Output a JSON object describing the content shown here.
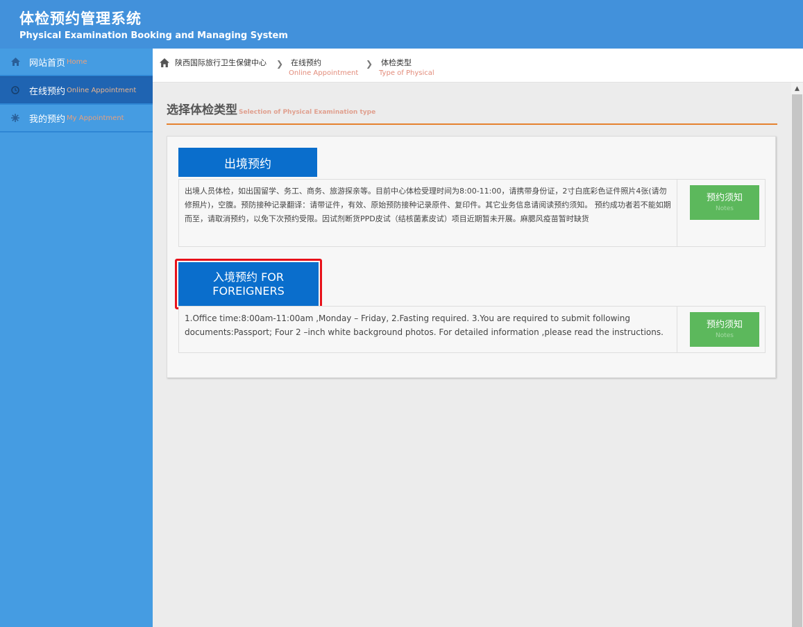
{
  "header": {
    "title_cn": "体检预约管理系统",
    "title_en": "Physical Examination Booking and Managing System"
  },
  "sidebar": {
    "items": [
      {
        "cn": "网站首页",
        "en": "Home",
        "icon": "home-icon"
      },
      {
        "cn": "在线预约",
        "en": "Online Appointment",
        "icon": "clock-icon",
        "active": true
      },
      {
        "cn": "我的预约",
        "en": "My Appointment",
        "icon": "gear-icon"
      }
    ]
  },
  "breadcrumb": {
    "root": "陕西国际旅行卫生保健中心",
    "items": [
      {
        "cn": "在线预约",
        "en": "Online Appointment"
      },
      {
        "cn": "体检类型",
        "en": "Type of Physical"
      }
    ]
  },
  "section": {
    "title_cn": "选择体检类型",
    "title_en": "Selection of Physical Examination type"
  },
  "exam_types": [
    {
      "tab_label": "出境预约",
      "description": "出境人员体检，如出国留学、务工、商务、旅游探亲等。目前中心体检受理时间为8:00-11:00，请携带身份证，2寸白底彩色证件照片4张(请勿修照片)，空腹。预防接种记录翻译：请带证件，有效、原始预防接种记录原件、复印件。其它业务信息请阅读预约须知。 预约成功者若不能如期而至，请取消预约，以免下次预约受限。因试剂断货PPD皮试（结核菌素皮试）项目近期暂未开展。麻腮风疫苗暂时缺货",
      "notes_cn": "预约须知",
      "notes_en": "Notes"
    },
    {
      "tab_label": "入境预约 FOR FOREIGNERS",
      "description": "1.Office time:8:00am-11:00am ,Monday – Friday, 2.Fasting required. 3.You are required to submit following documents:Passport; Four 2 –inch white background photos. For detailed information ,please read the instructions.",
      "notes_cn": "预约须知",
      "notes_en": "Notes"
    }
  ],
  "colors": {
    "header": "#4291db",
    "sidebar": "#459ce2",
    "tab_blue": "#0a6ecc",
    "notes_green": "#5cb85c",
    "highlight": "#e8111a",
    "divider_orange": "#e5822e"
  }
}
